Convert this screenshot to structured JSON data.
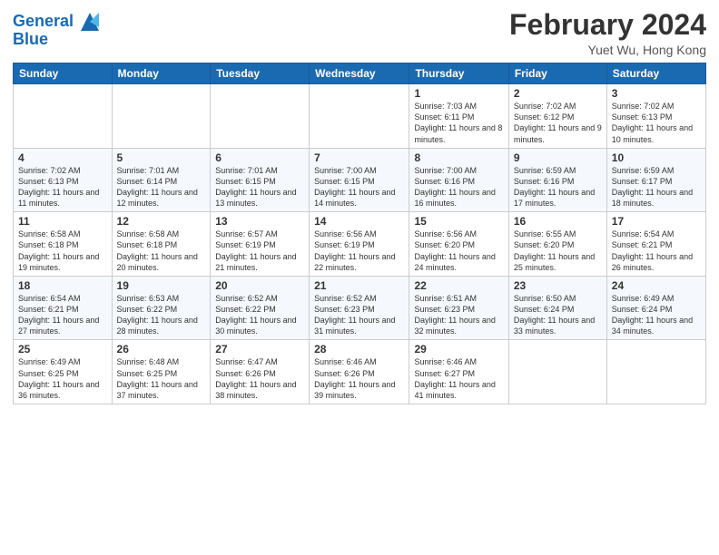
{
  "header": {
    "logo_line1": "General",
    "logo_line2": "Blue",
    "title": "February 2024",
    "subtitle": "Yuet Wu, Hong Kong"
  },
  "weekdays": [
    "Sunday",
    "Monday",
    "Tuesday",
    "Wednesday",
    "Thursday",
    "Friday",
    "Saturday"
  ],
  "weeks": [
    [
      {
        "day": "",
        "info": ""
      },
      {
        "day": "",
        "info": ""
      },
      {
        "day": "",
        "info": ""
      },
      {
        "day": "",
        "info": ""
      },
      {
        "day": "1",
        "info": "Sunrise: 7:03 AM\nSunset: 6:11 PM\nDaylight: 11 hours\nand 8 minutes."
      },
      {
        "day": "2",
        "info": "Sunrise: 7:02 AM\nSunset: 6:12 PM\nDaylight: 11 hours\nand 9 minutes."
      },
      {
        "day": "3",
        "info": "Sunrise: 7:02 AM\nSunset: 6:13 PM\nDaylight: 11 hours\nand 10 minutes."
      }
    ],
    [
      {
        "day": "4",
        "info": "Sunrise: 7:02 AM\nSunset: 6:13 PM\nDaylight: 11 hours\nand 11 minutes."
      },
      {
        "day": "5",
        "info": "Sunrise: 7:01 AM\nSunset: 6:14 PM\nDaylight: 11 hours\nand 12 minutes."
      },
      {
        "day": "6",
        "info": "Sunrise: 7:01 AM\nSunset: 6:15 PM\nDaylight: 11 hours\nand 13 minutes."
      },
      {
        "day": "7",
        "info": "Sunrise: 7:00 AM\nSunset: 6:15 PM\nDaylight: 11 hours\nand 14 minutes."
      },
      {
        "day": "8",
        "info": "Sunrise: 7:00 AM\nSunset: 6:16 PM\nDaylight: 11 hours\nand 16 minutes."
      },
      {
        "day": "9",
        "info": "Sunrise: 6:59 AM\nSunset: 6:16 PM\nDaylight: 11 hours\nand 17 minutes."
      },
      {
        "day": "10",
        "info": "Sunrise: 6:59 AM\nSunset: 6:17 PM\nDaylight: 11 hours\nand 18 minutes."
      }
    ],
    [
      {
        "day": "11",
        "info": "Sunrise: 6:58 AM\nSunset: 6:18 PM\nDaylight: 11 hours\nand 19 minutes."
      },
      {
        "day": "12",
        "info": "Sunrise: 6:58 AM\nSunset: 6:18 PM\nDaylight: 11 hours\nand 20 minutes."
      },
      {
        "day": "13",
        "info": "Sunrise: 6:57 AM\nSunset: 6:19 PM\nDaylight: 11 hours\nand 21 minutes."
      },
      {
        "day": "14",
        "info": "Sunrise: 6:56 AM\nSunset: 6:19 PM\nDaylight: 11 hours\nand 22 minutes."
      },
      {
        "day": "15",
        "info": "Sunrise: 6:56 AM\nSunset: 6:20 PM\nDaylight: 11 hours\nand 24 minutes."
      },
      {
        "day": "16",
        "info": "Sunrise: 6:55 AM\nSunset: 6:20 PM\nDaylight: 11 hours\nand 25 minutes."
      },
      {
        "day": "17",
        "info": "Sunrise: 6:54 AM\nSunset: 6:21 PM\nDaylight: 11 hours\nand 26 minutes."
      }
    ],
    [
      {
        "day": "18",
        "info": "Sunrise: 6:54 AM\nSunset: 6:21 PM\nDaylight: 11 hours\nand 27 minutes."
      },
      {
        "day": "19",
        "info": "Sunrise: 6:53 AM\nSunset: 6:22 PM\nDaylight: 11 hours\nand 28 minutes."
      },
      {
        "day": "20",
        "info": "Sunrise: 6:52 AM\nSunset: 6:22 PM\nDaylight: 11 hours\nand 30 minutes."
      },
      {
        "day": "21",
        "info": "Sunrise: 6:52 AM\nSunset: 6:23 PM\nDaylight: 11 hours\nand 31 minutes."
      },
      {
        "day": "22",
        "info": "Sunrise: 6:51 AM\nSunset: 6:23 PM\nDaylight: 11 hours\nand 32 minutes."
      },
      {
        "day": "23",
        "info": "Sunrise: 6:50 AM\nSunset: 6:24 PM\nDaylight: 11 hours\nand 33 minutes."
      },
      {
        "day": "24",
        "info": "Sunrise: 6:49 AM\nSunset: 6:24 PM\nDaylight: 11 hours\nand 34 minutes."
      }
    ],
    [
      {
        "day": "25",
        "info": "Sunrise: 6:49 AM\nSunset: 6:25 PM\nDaylight: 11 hours\nand 36 minutes."
      },
      {
        "day": "26",
        "info": "Sunrise: 6:48 AM\nSunset: 6:25 PM\nDaylight: 11 hours\nand 37 minutes."
      },
      {
        "day": "27",
        "info": "Sunrise: 6:47 AM\nSunset: 6:26 PM\nDaylight: 11 hours\nand 38 minutes."
      },
      {
        "day": "28",
        "info": "Sunrise: 6:46 AM\nSunset: 6:26 PM\nDaylight: 11 hours\nand 39 minutes."
      },
      {
        "day": "29",
        "info": "Sunrise: 6:46 AM\nSunset: 6:27 PM\nDaylight: 11 hours\nand 41 minutes."
      },
      {
        "day": "",
        "info": ""
      },
      {
        "day": "",
        "info": ""
      }
    ]
  ]
}
